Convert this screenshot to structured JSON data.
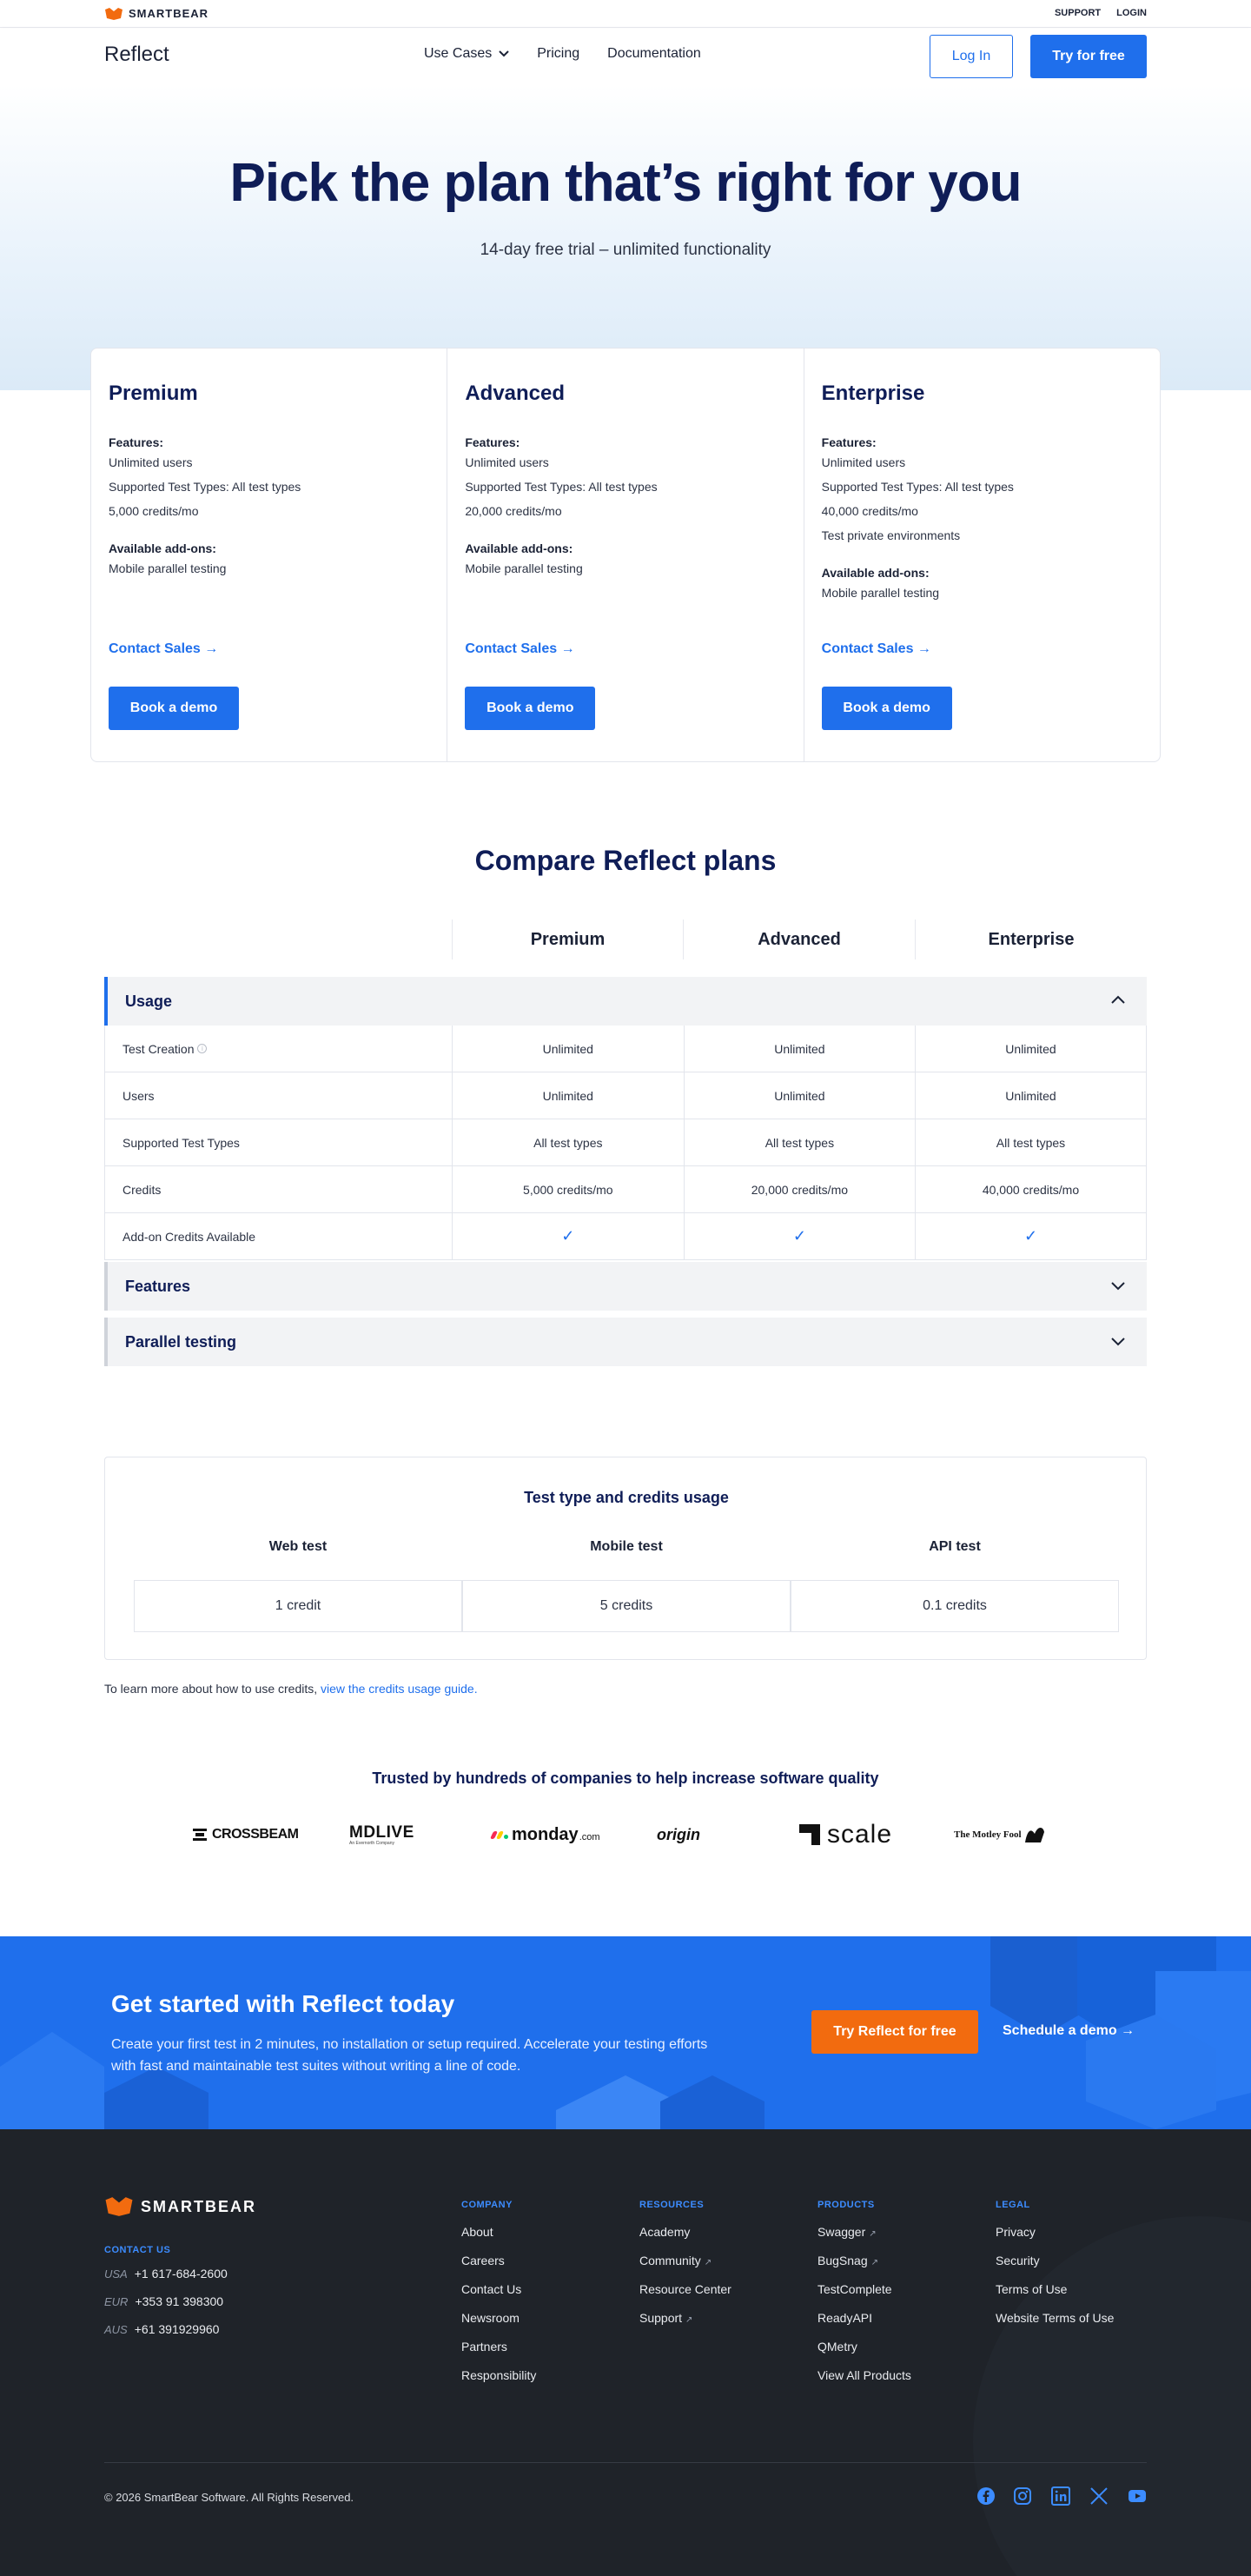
{
  "topbar": {
    "brand": "SMARTBEAR",
    "links": [
      "SUPPORT",
      "LOGIN"
    ]
  },
  "nav": {
    "product": "Reflect",
    "links": [
      "Use Cases",
      "Pricing",
      "Documentation"
    ],
    "login": "Log In",
    "try": "Try for free"
  },
  "hero": {
    "title": "Pick the plan that’s right for you",
    "subtitle": "14-day free trial – unlimited functionality"
  },
  "plans": [
    {
      "name": "Premium",
      "features_label": "Features:",
      "features": [
        "Unlimited users",
        "Supported Test Types: All test types",
        "5,000 credits/mo"
      ],
      "addons_label": "Available add-ons:",
      "addons": [
        "Mobile parallel testing"
      ],
      "contact": "Contact Sales",
      "demo": "Book a demo"
    },
    {
      "name": "Advanced",
      "features_label": "Features:",
      "features": [
        "Unlimited users",
        "Supported Test Types: All test types",
        "20,000 credits/mo"
      ],
      "addons_label": "Available add-ons:",
      "addons": [
        "Mobile parallel testing"
      ],
      "contact": "Contact Sales",
      "demo": "Book a demo"
    },
    {
      "name": "Enterprise",
      "features_label": "Features:",
      "features": [
        "Unlimited users",
        "Supported Test Types: All test types",
        "40,000 credits/mo",
        "Test private environments"
      ],
      "addons_label": "Available add-ons:",
      "addons": [
        "Mobile parallel testing"
      ],
      "contact": "Contact Sales",
      "demo": "Book a demo"
    }
  ],
  "compare": {
    "title": "Compare Reflect plans",
    "columns": [
      "Premium",
      "Advanced",
      "Enterprise"
    ],
    "sections": [
      "Usage",
      "Features",
      "Parallel testing"
    ],
    "rows": [
      {
        "label": "Test Creation",
        "values": [
          "Unlimited",
          "Unlimited",
          "Unlimited"
        ]
      },
      {
        "label": "Users",
        "values": [
          "Unlimited",
          "Unlimited",
          "Unlimited"
        ]
      },
      {
        "label": "Supported Test Types",
        "values": [
          "All test types",
          "All test types",
          "All test types"
        ]
      },
      {
        "label": "Credits",
        "values": [
          "5,000 credits/mo",
          "20,000 credits/mo",
          "40,000 credits/mo"
        ]
      },
      {
        "label": "Add-on Credits Available",
        "values": [
          "✓",
          "✓",
          "✓"
        ]
      }
    ]
  },
  "credits": {
    "title": "Test type and credits usage",
    "headers": [
      "Web test",
      "Mobile test",
      "API test"
    ],
    "values": [
      "1 credit",
      "5 credits",
      "0.1 credits"
    ],
    "learn_prefix": "To learn more about how to use credits, ",
    "learn_link": "view the credits usage guide."
  },
  "trusted": {
    "title": "Trusted by hundreds of companies to help increase software quality",
    "logos": [
      "CROSSBEAM",
      "MDLIVE",
      "monday",
      ".com",
      "origin",
      "scale",
      "The Motley Fool"
    ],
    "mdlive_sub": "An Evernorth Company"
  },
  "cta": {
    "title": "Get started with Reflect today",
    "text": "Create your first test in 2 minutes, no installation or setup required. Accelerate your testing efforts with fast and maintainable test suites without writing a line of code.",
    "primary": "Try Reflect for free",
    "secondary": "Schedule a demo"
  },
  "footer": {
    "brand": "SMARTBEAR",
    "contact_label": "CONTACT US",
    "phones": [
      {
        "region": "USA",
        "number": "+1 617-684-2600"
      },
      {
        "region": "EUR",
        "number": "+353 91 398300"
      },
      {
        "region": "AUS",
        "number": "+61 391929960"
      }
    ],
    "columns": [
      {
        "title": "COMPANY",
        "links": [
          "About",
          "Careers",
          "Contact Us",
          "Newsroom",
          "Partners",
          "Responsibility"
        ]
      },
      {
        "title": "RESOURCES",
        "links": [
          "Academy",
          "Community",
          "Resource Center",
          "Support"
        ]
      },
      {
        "title": "PRODUCTS",
        "links": [
          "Swagger",
          "BugSnag",
          "TestComplete",
          "ReadyAPI",
          "QMetry",
          "View All Products"
        ]
      },
      {
        "title": "LEGAL",
        "links": [
          "Privacy",
          "Security",
          "Terms of Use",
          "Website Terms of Use"
        ]
      }
    ],
    "copyright": "© 2026 SmartBear Software. All Rights Reserved.",
    "social": [
      "facebook-icon",
      "instagram-icon",
      "linkedin-icon",
      "x-icon",
      "youtube-icon"
    ]
  },
  "colors": {
    "accent": "#1f6fec",
    "navy": "#0f1d57",
    "orange": "#f26b0f",
    "footer_bg": "#1f2329"
  }
}
